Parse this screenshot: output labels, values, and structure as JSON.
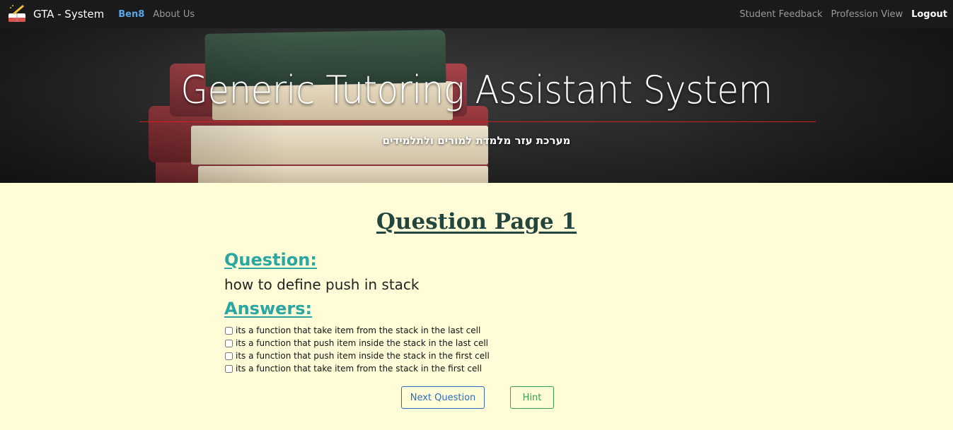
{
  "navbar": {
    "brand": "GTA - System",
    "user": "Ben8",
    "about": "About Us",
    "student_feedback": "Student Feedback",
    "profession_view": "Profession View",
    "logout": "Logout"
  },
  "hero": {
    "title": "Generic Tutoring Assistant System",
    "subtitle": "מערכת עזר מלמדת למורים ולתלמידים"
  },
  "main": {
    "page_title": "Question Page 1",
    "question_label": "Question:",
    "question_text": "how to define push in stack",
    "answers_label": "Answers:",
    "answers": [
      "its a function that take item from the stack in the last cell",
      "its a function that push item inside the stack in the last cell",
      "its a function that push item inside the stack in the first cell",
      "its a function that take item from the stack in the first cell"
    ],
    "next_button": "Next Question",
    "hint_button": "Hint"
  },
  "colors": {
    "navbar_bg": "#1a1a1a",
    "content_bg": "#fffdd8",
    "title_color": "#24453d",
    "section_color": "#2aa7a1",
    "rule_color": "#d21e1e",
    "next_button": "#2e6dbe",
    "hint_button": "#3a9e4a"
  }
}
